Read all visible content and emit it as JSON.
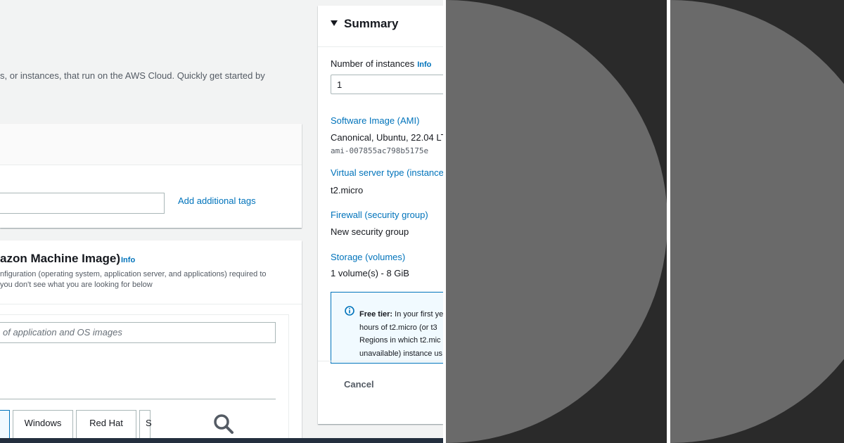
{
  "main": {
    "intro_text": "s, or instances, that run on the AWS Cloud. Quickly get started by",
    "name_tags": {
      "add_tags_label": "Add additional tags"
    },
    "ami": {
      "title": "azon Machine Image)",
      "info": "Info",
      "desc_line1": "nfiguration (operating system, application server, and applications) required to",
      "desc_line2": "you don't see what you are looking for below",
      "search_placeholder": "of application and OS images",
      "os_tiles": [
        "",
        "Windows",
        "Red Hat",
        "S"
      ]
    }
  },
  "summary": {
    "title": "Summary",
    "instances_label": "Number of instances",
    "instances_info": "Info",
    "instances_value": "1",
    "ami_label": "Software Image (AMI)",
    "ami_value": "Canonical, Ubuntu, 22.04 LT",
    "ami_id": "ami-007855ac798b5175e",
    "type_label": "Virtual server type (instance",
    "type_value": "t2.micro",
    "firewall_label": "Firewall (security group)",
    "firewall_value": "New security group",
    "storage_label": "Storage (volumes)",
    "storage_value": "1 volume(s) - 8 GiB",
    "free_tier": {
      "label": "Free tier:",
      "line1": "In your first ye",
      "line2": "hours of t2.micro (or t3",
      "line3": "Regions in which t2.mic",
      "line4": "unavailable) instance us"
    },
    "cancel_label": "Cancel"
  },
  "colors": {
    "link": "#0073bb",
    "page_bg": "#f2f3f3",
    "panel_bg": "#2a2a2a",
    "circle": "#6a6a6a"
  }
}
